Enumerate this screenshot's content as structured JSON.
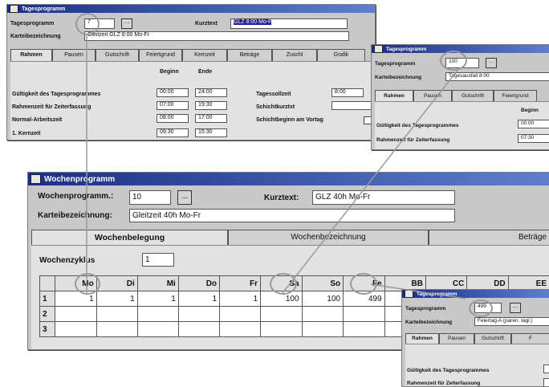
{
  "tages1": {
    "title": "Tagesprogramm",
    "tagesprogramm_label": "Tagesprogramm",
    "tagesprogramm_value": "7",
    "kurztext_label": "Kurztext",
    "kurztext_value": "GLZ 8:00 Mo-F",
    "kartei_label": "Karteibezeichnung",
    "kartei_value": "Gleitzeit GLZ 8:00 Mo-Fr",
    "tabs": [
      "Rahmen",
      "Pausen",
      "Gutschrift",
      "Feiertgrund",
      "Kernzeit",
      "Beträge",
      "Zuschl",
      "Grafik"
    ],
    "col_beginn": "Beginn",
    "col_ende": "Ende",
    "rows": [
      {
        "label": "Gültigkeit des Tagesprogrammes",
        "beginn": "00:00",
        "ende": "24:00"
      },
      {
        "label": "Rahmenzeit für Zeiterfassung",
        "beginn": "07:00",
        "ende": "19:30"
      },
      {
        "label": "Normal-Arbeitszeit",
        "beginn": "08:00",
        "ende": "17:00"
      },
      {
        "label": "1. Kernzeit",
        "beginn": "09:30",
        "ende": "15:30"
      }
    ],
    "sollzeit_label": "Tagessollzeit",
    "sollzeit_value": "8:00",
    "schicht_label": "Schichtkurztxt",
    "schichtbeginn_label": "Schichtbeginn am Vortag"
  },
  "tages2": {
    "title": "Tagesprogramm",
    "tagesprogramm_label": "Tagesprogramm",
    "tagesprogramm_value": "100",
    "kartei_label": "Karteibezeichnung",
    "kartei_value": "Tagesausfall 8:00",
    "tabs": [
      "Rahmen",
      "Pausen",
      "Gutschrift",
      "Feiertgrund"
    ],
    "col_beginn": "Beginn",
    "rows": [
      {
        "label": "Gültigkeit des Tagesprogrammes",
        "beginn": "00:00"
      },
      {
        "label": "Rahmenzeit für Zeiterfassung",
        "beginn": "07:30"
      }
    ]
  },
  "wochen": {
    "title": "Wochenprogramm",
    "wochenprogramm_label": "Wochenprogramm.:",
    "wochenprogramm_value": "10",
    "browse_label": "...",
    "kurztext_label": "Kurztext:",
    "kurztext_value": "GLZ 40h Mo-Fr",
    "kartei_label": "Karteibezeichnung:",
    "kartei_value": "Gleitzeit 40h Mo-Fr",
    "tabs": [
      "Wochenbelegung",
      "Wochenbezeichnung",
      "Beträge"
    ],
    "zyklus_label": "Wochenzyklus",
    "zyklus_value": "1",
    "days": [
      "Mo",
      "Di",
      "Mi",
      "Do",
      "Fr",
      "Sa",
      "So",
      "Fe",
      "BB",
      "CC",
      "DD",
      "EE"
    ],
    "rows": [
      {
        "n": "1",
        "values": [
          "1",
          "1",
          "1",
          "1",
          "1",
          "100",
          "100",
          "499"
        ]
      },
      {
        "n": "2",
        "values": []
      },
      {
        "n": "3",
        "values": []
      }
    ]
  },
  "tages3": {
    "title": "Tagesprogramm",
    "tagesprogramm_label": "Tagesprogramm",
    "tagesprogramm_value": "499",
    "kartei_label": "Karteibezeichnung",
    "kartei_value": "Feiertag-A (paren. tagl.)",
    "tabs": [
      "Rahmen",
      "Pausen",
      "Gutschrift",
      "F"
    ],
    "rows": [
      {
        "label": "Gültigkeit des Tagesprogrammes"
      },
      {
        "label": "Rahmenzeit für Zeiterfassung"
      }
    ]
  },
  "colors": {
    "titlebar": "#1a2f86",
    "window": "#c8c8c8",
    "panel": "#e2e2e2"
  }
}
